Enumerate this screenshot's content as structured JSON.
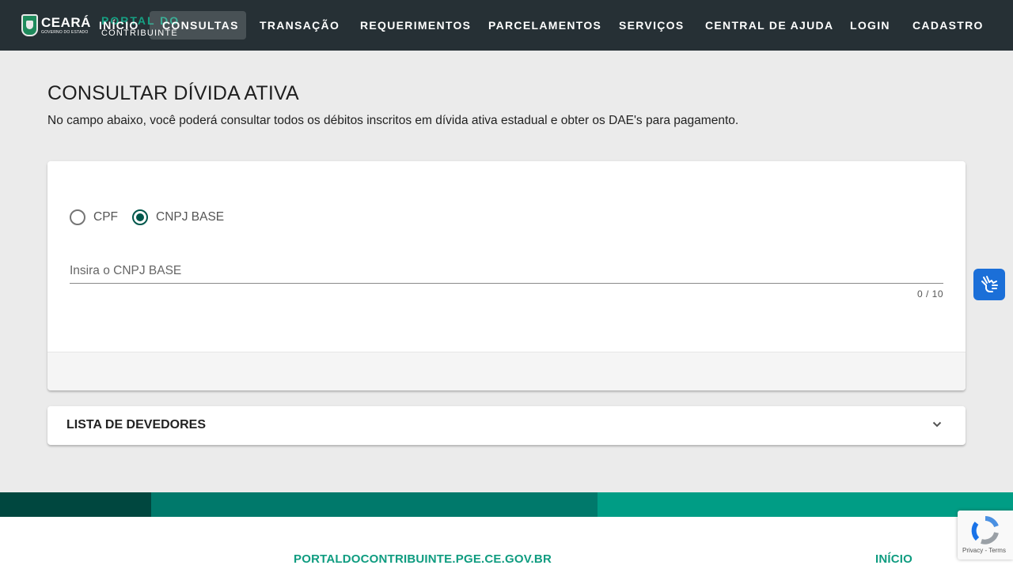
{
  "header": {
    "logo_main": "CEARÁ",
    "logo_sub": "GOVERNO DO ESTADO",
    "portal_title": "PORTAL DO",
    "portal_sub": "CONTRIBUINTE",
    "nav": [
      {
        "label": "INÍCIO"
      },
      {
        "label": "CONSULTAS",
        "active": true
      },
      {
        "label": "TRANSAÇÃO"
      },
      {
        "label": "REQUERIMENTOS"
      },
      {
        "label": "PARCELAMENTOS"
      },
      {
        "label": "SERVIÇOS"
      },
      {
        "label": "CENTRAL DE AJUDA"
      },
      {
        "label": "LOGIN"
      },
      {
        "label": "CADASTRO"
      }
    ]
  },
  "main": {
    "title": "CONSULTAR DÍVIDA ATIVA",
    "description": "No campo abaixo, você poderá consultar todos os débitos inscritos em dívida ativa estadual e obter os DAE's para pagamento.",
    "search": {
      "options": [
        {
          "label": "CPF",
          "checked": false
        },
        {
          "label": "CNPJ BASE",
          "checked": true
        }
      ],
      "placeholder": "Insira o CNPJ BASE",
      "value": "",
      "counter": "0 / 10"
    },
    "debtors_panel": {
      "title": "LISTA DE DEVEDORES"
    }
  },
  "footer": {
    "site": "PORTALDOCONTRIBUINTE.PGE.CE.GOV.BR",
    "home_link": "INÍCIO",
    "recaptcha_terms": "Privacy - Terms"
  },
  "colors": {
    "header_bg": "#263035",
    "accent": "#00574b",
    "stripe_dark": "#00473f",
    "stripe_mid": "#00796b",
    "stripe_light": "#009d85",
    "accessibility_button": "#1b6fd8"
  },
  "icons": {
    "expander": "chevron-down-icon",
    "accessibility": "sign-language-hands-icon",
    "recaptcha": "recaptcha-icon"
  }
}
